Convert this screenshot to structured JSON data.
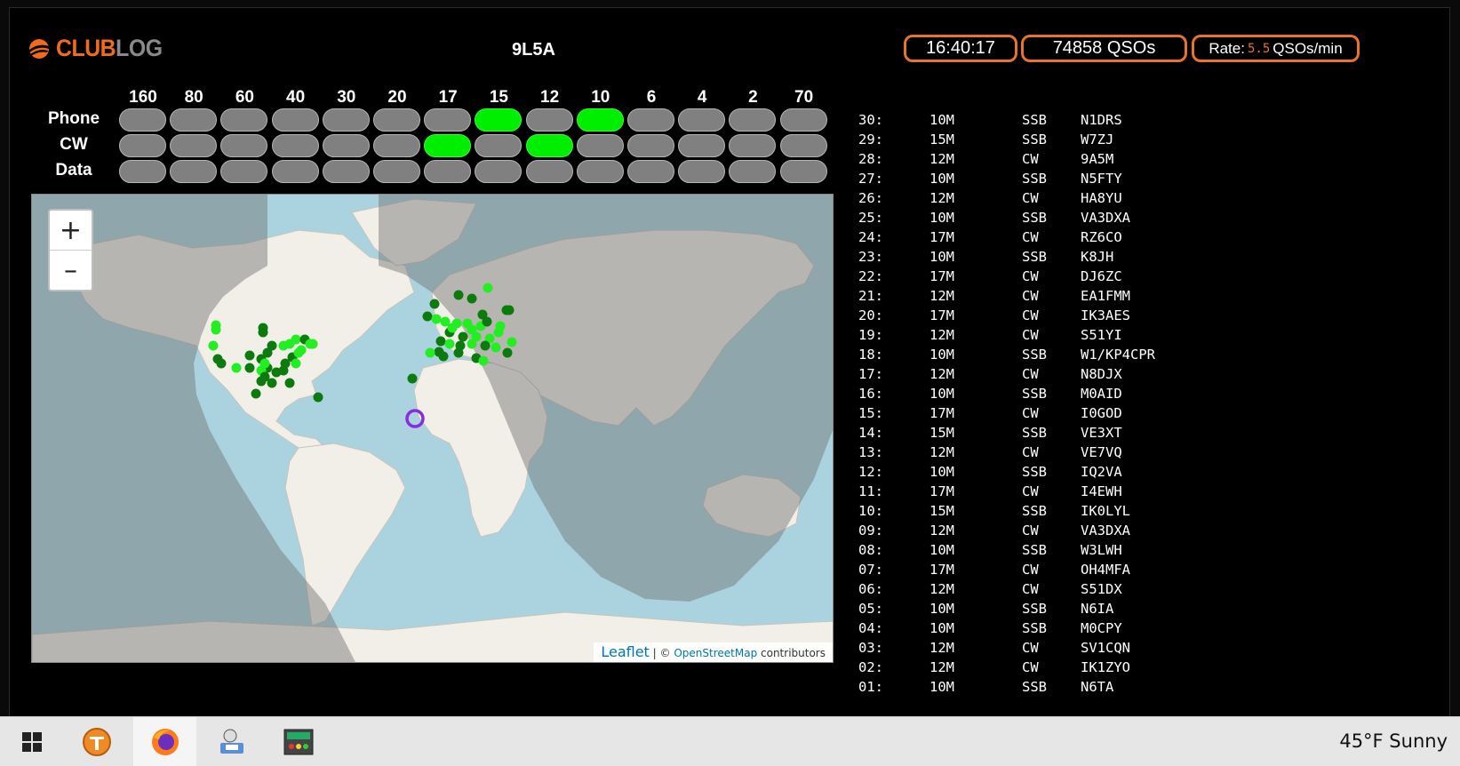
{
  "header": {
    "logo_club": "CLUB",
    "logo_log": "LOG",
    "callsign": "9L5A",
    "time": "16:40:17",
    "qso_count": "74858 QSOs",
    "rate_label": "Rate:",
    "rate_value": "5.5",
    "rate_unit": "QSOs/min"
  },
  "bands": [
    "160",
    "80",
    "60",
    "40",
    "30",
    "20",
    "17",
    "15",
    "12",
    "10",
    "6",
    "4",
    "2",
    "70"
  ],
  "modes": [
    "Phone",
    "CW",
    "Data"
  ],
  "active": {
    "Phone": [
      "15",
      "10"
    ],
    "CW": [
      "17",
      "12"
    ],
    "Data": []
  },
  "map": {
    "zoom_in": "+",
    "zoom_out": "–",
    "attribution_leaflet": "Leaflet",
    "attribution_sep": "| ©",
    "attribution_osm": "OpenStreetMap",
    "attribution_tail": "contributors"
  },
  "log": [
    {
      "num": "30:",
      "band": "10M",
      "mode": "SSB",
      "call": "N1DRS"
    },
    {
      "num": "29:",
      "band": "15M",
      "mode": "SSB",
      "call": "W7ZJ"
    },
    {
      "num": "28:",
      "band": "12M",
      "mode": "CW",
      "call": "9A5M"
    },
    {
      "num": "27:",
      "band": "10M",
      "mode": "SSB",
      "call": "N5FTY"
    },
    {
      "num": "26:",
      "band": "12M",
      "mode": "CW",
      "call": "HA8YU"
    },
    {
      "num": "25:",
      "band": "10M",
      "mode": "SSB",
      "call": "VA3DXA"
    },
    {
      "num": "24:",
      "band": "17M",
      "mode": "CW",
      "call": "RZ6CO"
    },
    {
      "num": "23:",
      "band": "10M",
      "mode": "SSB",
      "call": "K8JH"
    },
    {
      "num": "22:",
      "band": "17M",
      "mode": "CW",
      "call": "DJ6ZC"
    },
    {
      "num": "21:",
      "band": "12M",
      "mode": "CW",
      "call": "EA1FMM"
    },
    {
      "num": "20:",
      "band": "17M",
      "mode": "CW",
      "call": "IK3AES"
    },
    {
      "num": "19:",
      "band": "12M",
      "mode": "CW",
      "call": "S51YI"
    },
    {
      "num": "18:",
      "band": "10M",
      "mode": "SSB",
      "call": "W1/KP4CPR"
    },
    {
      "num": "17:",
      "band": "12M",
      "mode": "CW",
      "call": "N8DJX"
    },
    {
      "num": "16:",
      "band": "10M",
      "mode": "SSB",
      "call": "M0AID"
    },
    {
      "num": "15:",
      "band": "17M",
      "mode": "CW",
      "call": "I0GOD"
    },
    {
      "num": "14:",
      "band": "15M",
      "mode": "SSB",
      "call": "VE3XT"
    },
    {
      "num": "13:",
      "band": "12M",
      "mode": "CW",
      "call": "VE7VQ"
    },
    {
      "num": "12:",
      "band": "10M",
      "mode": "SSB",
      "call": "IQ2VA"
    },
    {
      "num": "11:",
      "band": "17M",
      "mode": "CW",
      "call": "I4EWH"
    },
    {
      "num": "10:",
      "band": "15M",
      "mode": "SSB",
      "call": "IK0LYL"
    },
    {
      "num": "09:",
      "band": "12M",
      "mode": "CW",
      "call": "VA3DXA"
    },
    {
      "num": "08:",
      "band": "10M",
      "mode": "SSB",
      "call": "W3LWH"
    },
    {
      "num": "07:",
      "band": "17M",
      "mode": "CW",
      "call": "OH4MFA"
    },
    {
      "num": "06:",
      "band": "12M",
      "mode": "CW",
      "call": "S51DX"
    },
    {
      "num": "05:",
      "band": "10M",
      "mode": "SSB",
      "call": "N6IA"
    },
    {
      "num": "04:",
      "band": "10M",
      "mode": "SSB",
      "call": "M0CPY"
    },
    {
      "num": "03:",
      "band": "12M",
      "mode": "CW",
      "call": "SV1CQN"
    },
    {
      "num": "02:",
      "band": "12M",
      "mode": "CW",
      "call": "IK1ZYO"
    },
    {
      "num": "01:",
      "band": "10M",
      "mode": "SSB",
      "call": "N6TA"
    }
  ],
  "taskbar": {
    "icons": [
      "windows-start-icon",
      "toolbox-app-icon",
      "firefox-icon",
      "log-app-icon",
      "radio-app-icon"
    ],
    "weather": "45°F  Sunny"
  },
  "colors": {
    "accent": "#e8742c",
    "active_cell": "#00ee00",
    "inactive_cell": "#808080",
    "dot_dark": "#0d7a0d",
    "dot_bright": "#22ee22",
    "station_marker": "#8a2be2"
  }
}
